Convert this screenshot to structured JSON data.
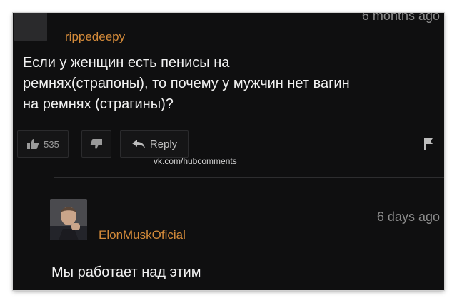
{
  "comment1": {
    "username": "rippedeepy",
    "timestamp": "6 months ago",
    "text": "Если у женщин есть пенисы на ремнях(страпоны), то почему у мужчин нет вагин на ремнях (страгины)?",
    "like_count": "535",
    "reply_label": "Reply"
  },
  "watermark": "vk.com/hubcomments",
  "comment2": {
    "username": "ElonMuskOficial",
    "timestamp": "6 days ago",
    "text": "Мы работает над этим"
  },
  "icons": {
    "like": "thumbs-up-icon",
    "dislike": "thumbs-down-icon",
    "reply": "reply-arrow-icon",
    "flag": "flag-icon"
  },
  "colors": {
    "background": "#0f0f10",
    "username": "#d38a3a",
    "text": "#f1f1f1",
    "muted": "#8b8b8b"
  }
}
